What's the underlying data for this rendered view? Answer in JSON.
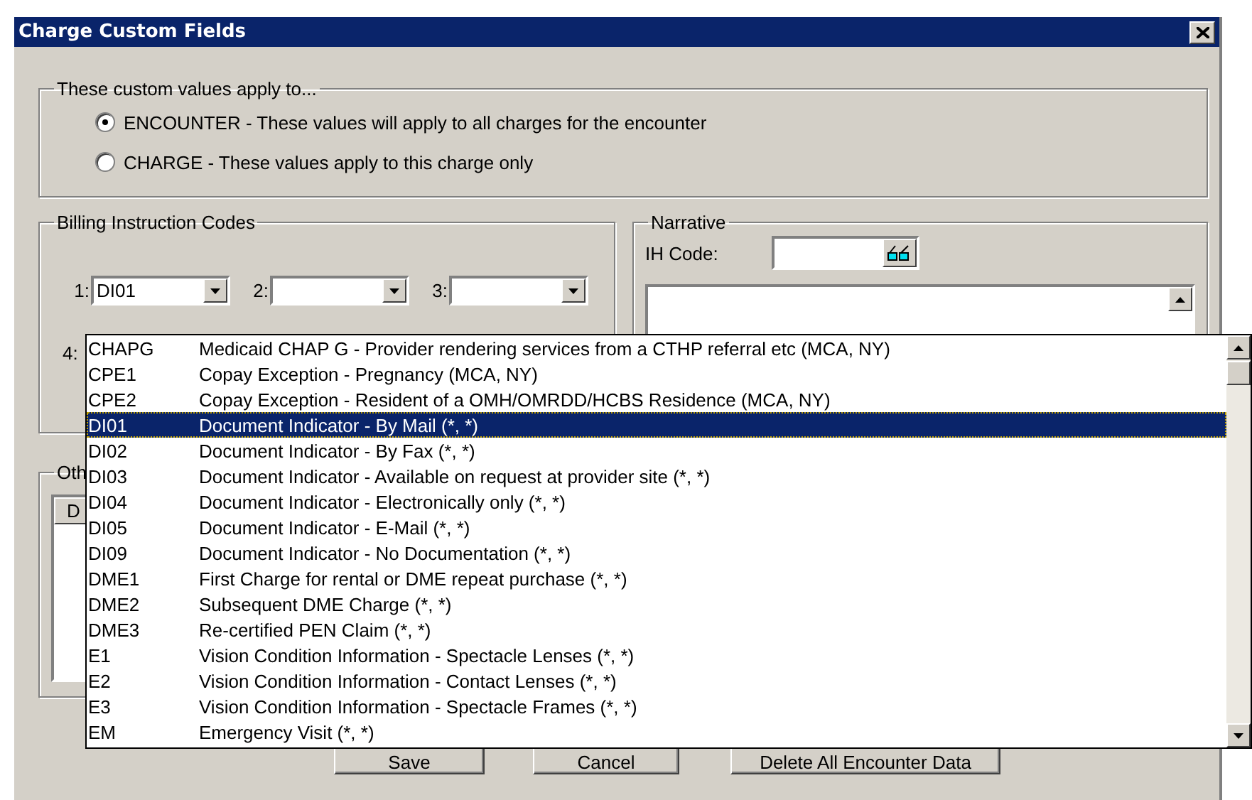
{
  "window": {
    "title": "Charge Custom Fields"
  },
  "apply_to": {
    "label": "These custom values apply to...",
    "options": [
      {
        "label": "ENCOUNTER - These values will apply to all charges for the encounter",
        "selected": true
      },
      {
        "label": "CHARGE - These values apply to this charge only",
        "selected": false
      }
    ]
  },
  "billing_codes": {
    "label": "Billing Instruction Codes",
    "slots": [
      {
        "label": "1:",
        "value": "DI01"
      },
      {
        "label": "2:"
      },
      {
        "label": "3:"
      }
    ],
    "fourth_label": "4:"
  },
  "narrative": {
    "label": "Narrative",
    "ih_code_label": "IH Code:"
  },
  "other": {
    "label": "Oth",
    "column_1": "D"
  },
  "buttons": [
    "Save",
    "Cancel",
    "Delete All Encounter Data"
  ],
  "dropdown": {
    "items": [
      {
        "code": "CHAPG",
        "description": "Medicaid CHAP G - Provider rendering services from a CTHP referral etc (MCA, NY)",
        "selected": false
      },
      {
        "code": "CPE1",
        "description": "Copay Exception - Pregnancy (MCA, NY)",
        "selected": false
      },
      {
        "code": "CPE2",
        "description": "Copay Exception - Resident of a OMH/OMRDD/HCBS Residence (MCA, NY)",
        "selected": false
      },
      {
        "code": "DI01",
        "description": "Document Indicator - By Mail (*, *)",
        "selected": true
      },
      {
        "code": "DI02",
        "description": "Document Indicator - By Fax (*, *)",
        "selected": false
      },
      {
        "code": "DI03",
        "description": "Document Indicator - Available on request at provider site (*, *)",
        "selected": false
      },
      {
        "code": "DI04",
        "description": "Document Indicator - Electronically only (*, *)",
        "selected": false
      },
      {
        "code": "DI05",
        "description": "Document Indicator - E-Mail (*, *)",
        "selected": false
      },
      {
        "code": "DI09",
        "description": "Document Indicator - No Documentation (*, *)",
        "selected": false
      },
      {
        "code": "DME1",
        "description": "First Charge for rental or DME repeat purchase (*, *)",
        "selected": false
      },
      {
        "code": "DME2",
        "description": "Subsequent DME Charge (*, *)",
        "selected": false
      },
      {
        "code": "DME3",
        "description": "Re-certified PEN Claim (*, *)",
        "selected": false
      },
      {
        "code": "E1",
        "description": "Vision Condition Information - Spectacle Lenses (*, *)",
        "selected": false
      },
      {
        "code": "E2",
        "description": "Vision Condition Information - Contact Lenses (*, *)",
        "selected": false
      },
      {
        "code": "E3",
        "description": "Vision Condition Information - Spectacle Frames (*, *)",
        "selected": false
      },
      {
        "code": "EM",
        "description": "Emergency Visit (*, *)",
        "selected": false
      }
    ]
  }
}
